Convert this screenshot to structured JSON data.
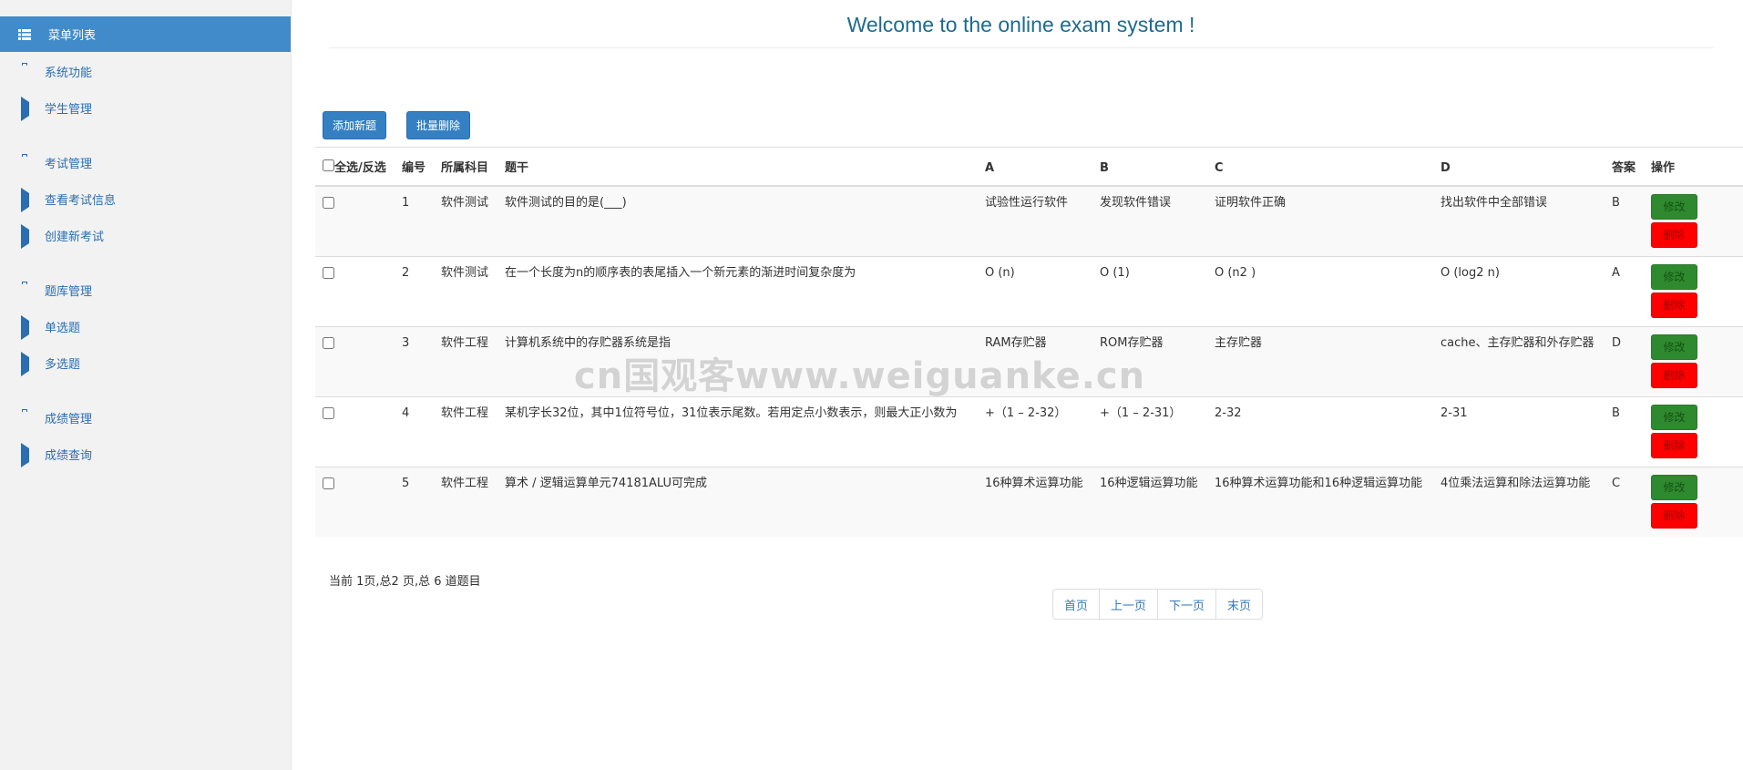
{
  "colors": {
    "sidebar_active": "#428bca",
    "link": "#2a6eb1",
    "edit": "#2f8a2f",
    "delete": "#ff0000"
  },
  "sidebar": {
    "header": "菜单列表",
    "groups": [
      {
        "label": "系统功能",
        "icon": "briefcase-icon",
        "items": [
          {
            "label": "学生管理"
          }
        ]
      },
      {
        "label": "考试管理",
        "icon": "briefcase-icon",
        "items": [
          {
            "label": "查看考试信息"
          },
          {
            "label": "创建新考试"
          }
        ]
      },
      {
        "label": "题库管理",
        "icon": "briefcase-icon",
        "items": [
          {
            "label": "单选题"
          },
          {
            "label": "多选题"
          }
        ]
      },
      {
        "label": "成绩管理",
        "icon": "briefcase-icon",
        "items": [
          {
            "label": "成绩查询"
          }
        ]
      }
    ]
  },
  "main": {
    "title": "Welcome to the online exam system !",
    "add_button": "添加新题",
    "batch_delete_button": "批量删除",
    "table": {
      "headers": {
        "select_all": "全选/反选",
        "id": "编号",
        "subject": "所属科目",
        "stem": "题干",
        "a": "A",
        "b": "B",
        "c": "C",
        "d": "D",
        "answer": "答案",
        "ops": "操作"
      },
      "edit_label": "修改",
      "delete_label": "删除",
      "rows": [
        {
          "id": "1",
          "subject": "软件测试",
          "stem": "软件测试的目的是(___)",
          "a": "试验性运行软件",
          "b": "发现软件错误",
          "c": "证明软件正确",
          "d": "找出软件中全部错误",
          "answer": "B"
        },
        {
          "id": "2",
          "subject": "软件测试",
          "stem": "在一个长度为n的顺序表的表尾插入一个新元素的渐进时间复杂度为",
          "a": "O (n)",
          "b": "O (1)",
          "c": "O (n2 )",
          "d": "O (log2 n)",
          "answer": "A"
        },
        {
          "id": "3",
          "subject": "软件工程",
          "stem": "计算机系统中的存贮器系统是指",
          "a": "RAM存贮器",
          "b": "ROM存贮器",
          "c": "主存贮器",
          "d": "cache、主存贮器和外存贮器",
          "answer": "D"
        },
        {
          "id": "4",
          "subject": "软件工程",
          "stem": "某机字长32位，其中1位符号位，31位表示尾数。若用定点小数表示，则最大正小数为",
          "a": "+（1 – 2-32）",
          "b": "+（1 – 2-31）",
          "c": "2-32",
          "d": "2-31",
          "answer": "B"
        },
        {
          "id": "5",
          "subject": "软件工程",
          "stem": "算术 / 逻辑运算单元74181ALU可完成",
          "a": "16种算术运算功能",
          "b": "16种逻辑运算功能",
          "c": "16种算术运算功能和16种逻辑运算功能",
          "d": "4位乘法运算和除法运算功能",
          "answer": "C"
        }
      ]
    },
    "page_info": "当前 1页,总2 页,总 6 道题目",
    "pager": {
      "first": "首页",
      "prev": "上一页",
      "next": "下一页",
      "last": "末页"
    },
    "watermark": "cn国观客www.weiguanke.cn"
  }
}
